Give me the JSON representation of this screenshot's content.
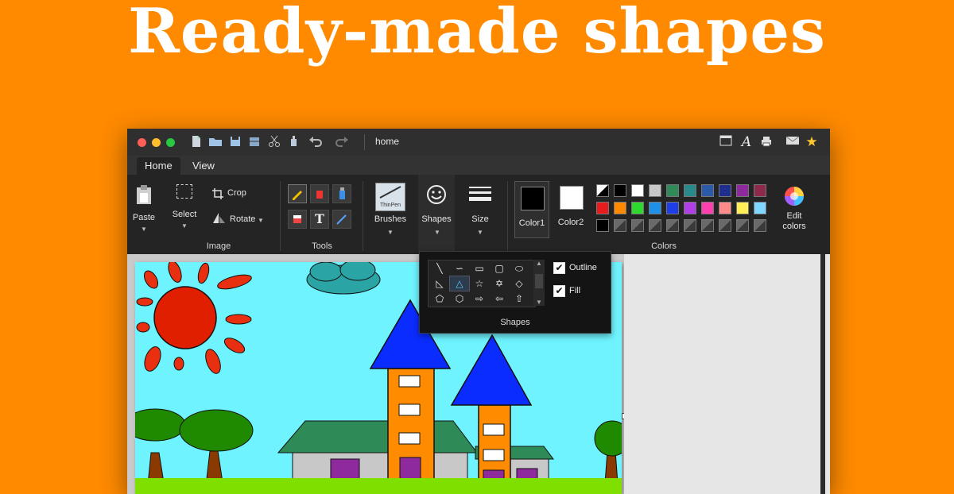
{
  "headline": "Ready-made shapes",
  "window": {
    "doc_title": "home",
    "traffic_lights": {
      "close": "#ff5f57",
      "minimize": "#ffbd2e",
      "zoom": "#28c840"
    },
    "quick_access_icons": [
      "new-file-icon",
      "open-folder-icon",
      "save-icon",
      "scan-icon",
      "cut-icon",
      "paint-bucket-icon",
      "undo-icon",
      "redo-icon"
    ],
    "right_icons": [
      "window-layout-icon",
      "font-icon",
      "print-icon",
      "mail-icon",
      "star-icon"
    ]
  },
  "tabs": [
    {
      "label": "Home",
      "active": true
    },
    {
      "label": "View",
      "active": false
    }
  ],
  "ribbon": {
    "paste": "Paste",
    "select": "Select",
    "crop": "Crop",
    "rotate": "Rotate",
    "image_group": "Image",
    "tools_group": "Tools",
    "brushes": "Brushes",
    "brush_icon_text": "ThinPen",
    "shapes": "Shapes",
    "size": "Size",
    "color1": "Color1",
    "color2": "Color2",
    "colors_group": "Colors",
    "edit_colors": "Edit colors",
    "color1_value": "#000000",
    "color2_value": "#ffffff",
    "palette_row1": [
      "#ffffff",
      "#000000",
      "#ffffff",
      "#c8c8c8",
      "#2e8b57",
      "#2a8a8a",
      "#2b5aa8",
      "#1e2f8f",
      "#8e2a9e",
      "#8e2a4e"
    ],
    "palette_row2": [
      "#e81c1c",
      "#ff8a00",
      "#2fd82f",
      "#1e90e8",
      "#1e3fe8",
      "#b03fe8",
      "#ff3fb0",
      "#ff8a8a",
      "#ffee55",
      "#7fd6ff"
    ],
    "palette_row3": [
      "#000000",
      "#555555",
      "#555555",
      "#555555",
      "#555555",
      "#555555",
      "#555555",
      "#555555",
      "#555555",
      "#555555"
    ]
  },
  "shapes_popup": {
    "title": "Shapes",
    "outline": "Outline",
    "fill": "Fill",
    "outline_checked": true,
    "fill_checked": true,
    "grid": [
      "line",
      "curve",
      "rectangle",
      "rounded-rectangle",
      "oval",
      "right-triangle",
      "triangle",
      "star",
      "hexagram",
      "diamond",
      "pentagon",
      "hexagon",
      "arrow-right",
      "arrow-left",
      "arrow-up"
    ],
    "selected": "triangle"
  },
  "drawing": {
    "sky_color": "#6ff4ff",
    "sun_color": "#e01e00",
    "roof_color": "#0a2cff",
    "tower_color": "#ff8c00",
    "tree_color": "#1f8a00",
    "grass_color": "#7fe000"
  }
}
